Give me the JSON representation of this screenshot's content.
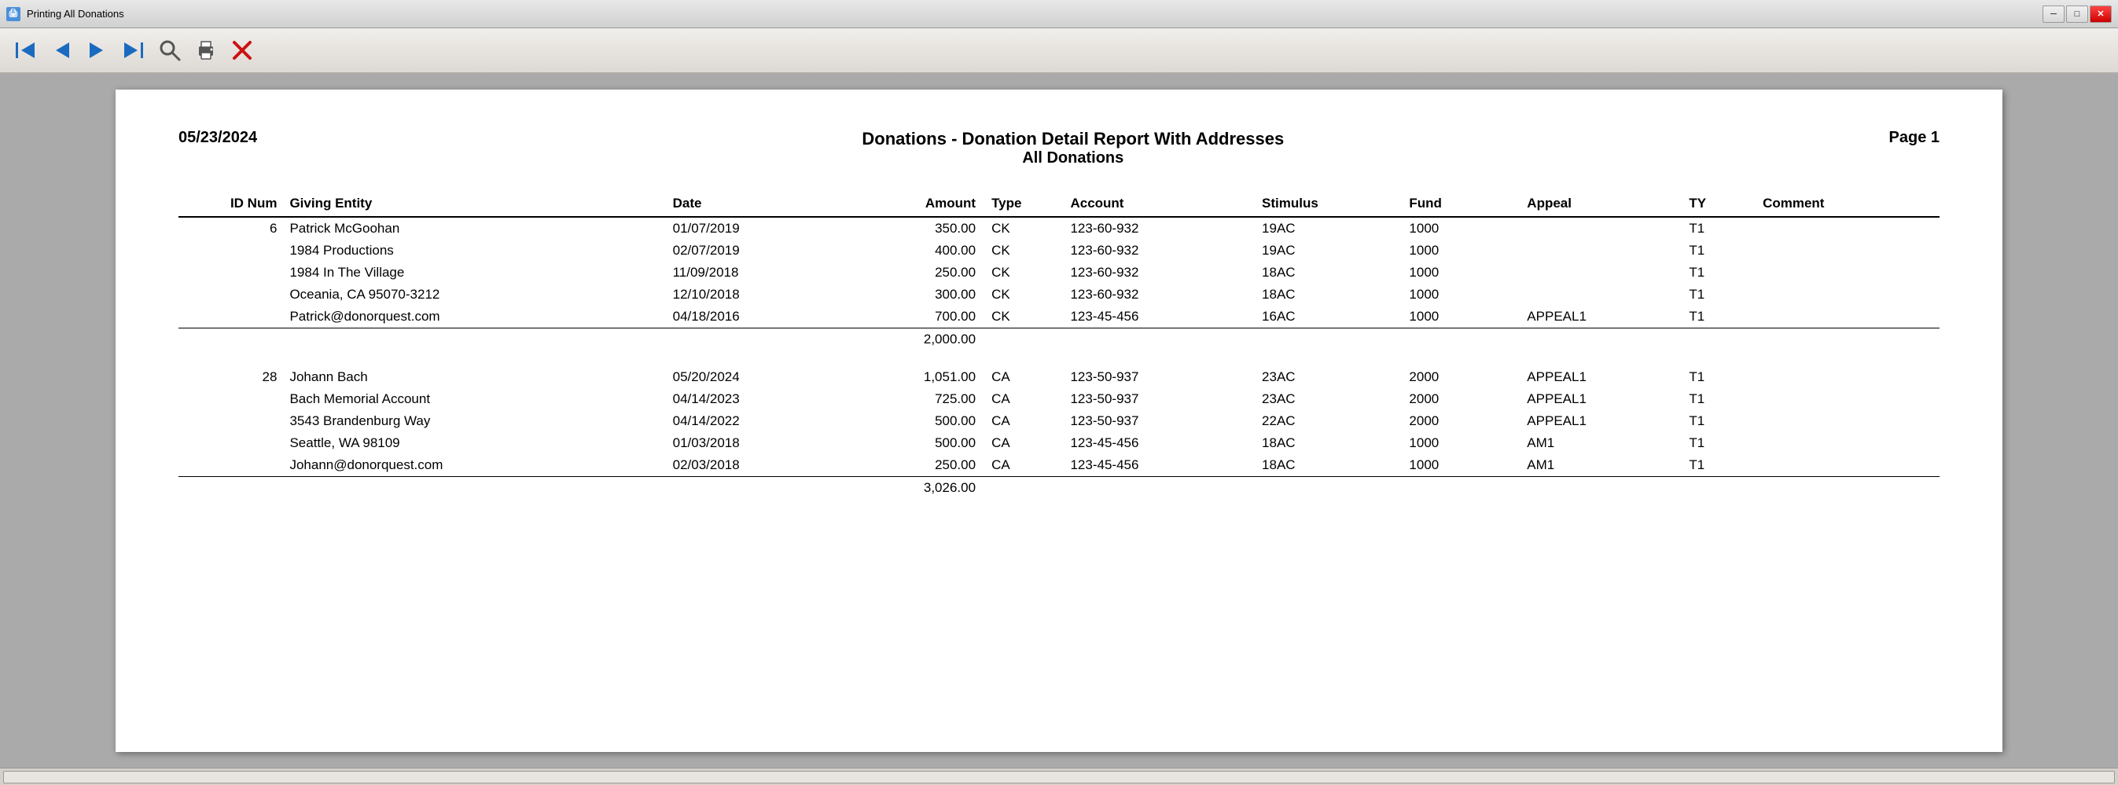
{
  "window": {
    "title": "Printing All Donations",
    "icon": "P"
  },
  "titlebar": {
    "minimize_label": "─",
    "maximize_label": "□",
    "close_label": "✕"
  },
  "toolbar": {
    "buttons": [
      {
        "name": "first-page-button",
        "icon": "⏮",
        "label": "First Page"
      },
      {
        "name": "prev-page-button",
        "icon": "◀",
        "label": "Previous Page"
      },
      {
        "name": "next-page-button",
        "icon": "▶",
        "label": "Next Page"
      },
      {
        "name": "last-page-button",
        "icon": "⏭",
        "label": "Last Page"
      },
      {
        "name": "search-button",
        "icon": "🔍",
        "label": "Search"
      },
      {
        "name": "print-button",
        "icon": "🖨",
        "label": "Print"
      },
      {
        "name": "close-button",
        "icon": "✕",
        "label": "Close"
      }
    ]
  },
  "report": {
    "date": "05/23/2024",
    "title_main": "Donations - Donation Detail Report With Addresses",
    "title_sub": "All Donations",
    "page": "Page 1",
    "columns": {
      "id_num": "ID Num",
      "giving_entity": "Giving Entity",
      "date": "Date",
      "amount": "Amount",
      "type": "Type",
      "account": "Account",
      "stimulus": "Stimulus",
      "fund": "Fund",
      "appeal": "Appeal",
      "ty": "TY",
      "comment": "Comment"
    },
    "donors": [
      {
        "id": "6",
        "name": "Patrick McGoohan",
        "address1": "1984 Productions",
        "address2": "1984 In The Village",
        "address3": "Oceania, CA  95070-3212",
        "email": "Patrick@donorquest.com",
        "transactions": [
          {
            "date": "01/07/2019",
            "amount": "350.00",
            "type": "CK",
            "account": "123-60-932",
            "stimulus": "19AC",
            "fund": "1000",
            "appeal": "",
            "ty": "T1"
          },
          {
            "date": "02/07/2019",
            "amount": "400.00",
            "type": "CK",
            "account": "123-60-932",
            "stimulus": "19AC",
            "fund": "1000",
            "appeal": "",
            "ty": "T1"
          },
          {
            "date": "11/09/2018",
            "amount": "250.00",
            "type": "CK",
            "account": "123-60-932",
            "stimulus": "18AC",
            "fund": "1000",
            "appeal": "",
            "ty": "T1"
          },
          {
            "date": "12/10/2018",
            "amount": "300.00",
            "type": "CK",
            "account": "123-60-932",
            "stimulus": "18AC",
            "fund": "1000",
            "appeal": "",
            "ty": "T1"
          },
          {
            "date": "04/18/2016",
            "amount": "700.00",
            "type": "CK",
            "account": "123-45-456",
            "stimulus": "16AC",
            "fund": "1000",
            "appeal": "APPEAL1",
            "ty": "T1"
          }
        ],
        "subtotal": "2,000.00"
      },
      {
        "id": "28",
        "name": "Johann Bach",
        "address1": "Bach Memorial Account",
        "address2": "3543 Brandenburg Way",
        "address3": "Seattle, WA  98109",
        "email": "Johann@donorquest.com",
        "transactions": [
          {
            "date": "05/20/2024",
            "amount": "1,051.00",
            "type": "CA",
            "account": "123-50-937",
            "stimulus": "23AC",
            "fund": "2000",
            "appeal": "APPEAL1",
            "ty": "T1"
          },
          {
            "date": "04/14/2023",
            "amount": "725.00",
            "type": "CA",
            "account": "123-50-937",
            "stimulus": "23AC",
            "fund": "2000",
            "appeal": "APPEAL1",
            "ty": "T1"
          },
          {
            "date": "04/14/2022",
            "amount": "500.00",
            "type": "CA",
            "account": "123-50-937",
            "stimulus": "22AC",
            "fund": "2000",
            "appeal": "APPEAL1",
            "ty": "T1"
          },
          {
            "date": "01/03/2018",
            "amount": "500.00",
            "type": "CA",
            "account": "123-45-456",
            "stimulus": "18AC",
            "fund": "1000",
            "appeal": "AM1",
            "ty": "T1"
          },
          {
            "date": "02/03/2018",
            "amount": "250.00",
            "type": "CA",
            "account": "123-45-456",
            "stimulus": "18AC",
            "fund": "1000",
            "appeal": "AM1",
            "ty": "T1"
          }
        ],
        "subtotal": "3,026.00"
      }
    ]
  }
}
